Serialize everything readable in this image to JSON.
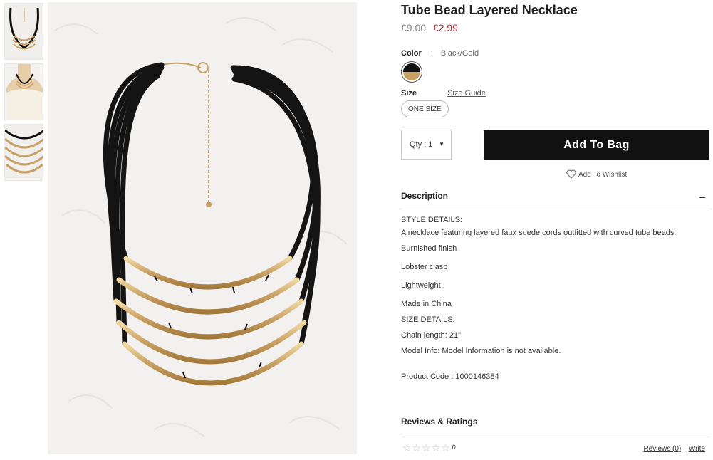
{
  "product": {
    "title": "Tube Bead Layered Necklace",
    "price_original": "£9.00",
    "price_sale": "£2.99"
  },
  "color": {
    "label": "Color",
    "separator": ":",
    "value": "Black/Gold",
    "swatch_colors": [
      "#111111",
      "#c9a063"
    ]
  },
  "size": {
    "label": "Size",
    "guide_label": "Size Guide",
    "option": "ONE SIZE"
  },
  "qty": {
    "label": "Qty : 1"
  },
  "actions": {
    "add_to_bag": "Add To Bag",
    "wishlist": "Add To Wishlist"
  },
  "description": {
    "heading": "Description",
    "collapse_symbol": "–",
    "lines": [
      "STYLE DETAILS:",
      "A necklace featuring layered faux suede cords outfitted with curved tube beads.",
      "Burnished finish",
      "Lobster clasp",
      "Lightweight",
      "Made in China",
      "SIZE DETAILS:",
      "Chain length: 21\"",
      "Model Info: Model Information is not available."
    ],
    "product_code": "Product Code : 1000146384"
  },
  "reviews": {
    "heading": "Reviews & Ratings",
    "stars": "☆☆☆☆☆",
    "rating_count": "0",
    "reviews_link": "Reviews (0)",
    "separator": "|",
    "write_link": "Write"
  },
  "gallery": {
    "thumbnails": [
      "necklace-flat-thumb",
      "necklace-worn-thumb",
      "necklace-closeup-thumb"
    ],
    "main_image": "necklace-main-image"
  },
  "colors": {
    "sale": "#c0282d",
    "button": "#111111",
    "gold": "#c9a063"
  }
}
